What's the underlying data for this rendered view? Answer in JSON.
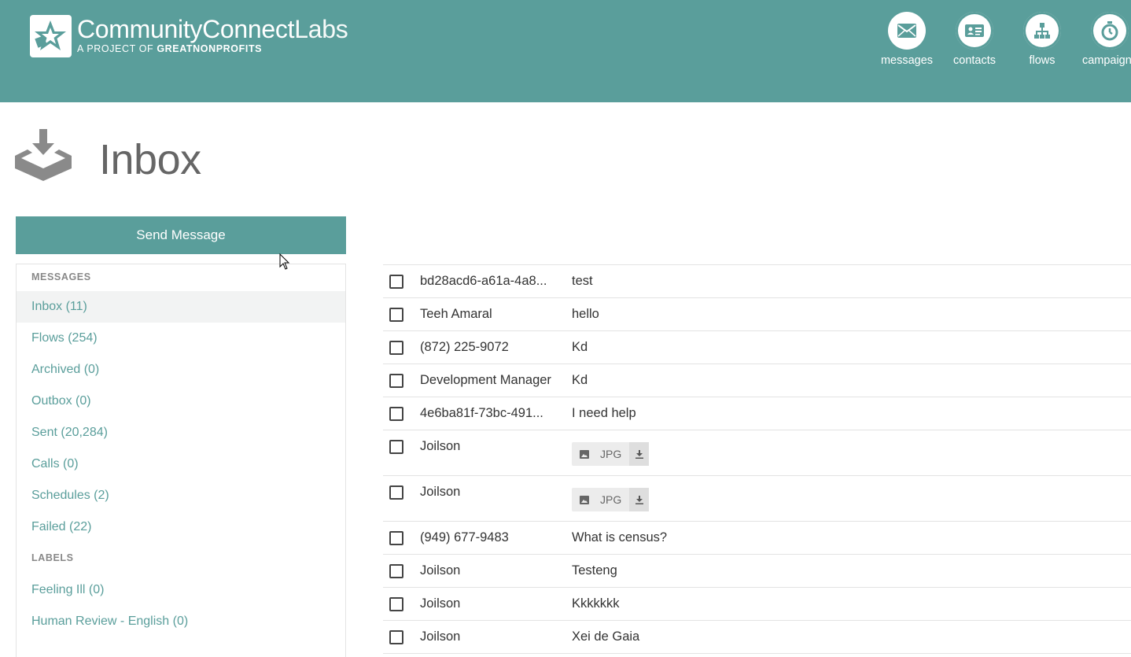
{
  "brand": {
    "title_main": "CommunityConnect",
    "title_light": "Labs",
    "subtitle_prefix": "A PROJECT OF ",
    "subtitle_bold": "GREATNONPROFITS"
  },
  "nav": {
    "items": [
      {
        "label": "messages",
        "icon": "envelope-icon"
      },
      {
        "label": "contacts",
        "icon": "contact-card-icon"
      },
      {
        "label": "flows",
        "icon": "flow-tree-icon"
      },
      {
        "label": "campaigns",
        "icon": "stopwatch-icon"
      }
    ]
  },
  "page": {
    "title": "Inbox",
    "icon": "inbox-download-icon"
  },
  "send_button": "Send Message",
  "sidebar": {
    "messages_heading": "MESSAGES",
    "items": [
      "Inbox (11)",
      "Flows (254)",
      "Archived (0)",
      "Outbox (0)",
      "Sent (20,284)",
      "Calls (0)",
      "Schedules (2)",
      "Failed (22)"
    ],
    "labels_heading": "LABELS",
    "labels": [
      "Feeling Ill (0)",
      "Human Review - English (0)"
    ]
  },
  "messages": [
    {
      "contact": "bd28acd6-a61a-4a8...",
      "text": "test"
    },
    {
      "contact": "Teeh Amaral",
      "text": "hello"
    },
    {
      "contact": "(872) 225-9072",
      "text": "Kd"
    },
    {
      "contact": "Development Manager",
      "text": "Kd"
    },
    {
      "contact": "4e6ba81f-73bc-491...",
      "text": "I need help"
    },
    {
      "contact": "Joilson",
      "attachment": "JPG"
    },
    {
      "contact": "Joilson",
      "attachment": "JPG"
    },
    {
      "contact": "(949) 677-9483",
      "text": "What is census?"
    },
    {
      "contact": "Joilson",
      "text": "Testeng"
    },
    {
      "contact": "Joilson",
      "text": "Kkkkkkk"
    },
    {
      "contact": "Joilson",
      "text": "Xei de Gaia"
    }
  ],
  "colors": {
    "brand": "#5a9e9b",
    "link": "#5a9e9b",
    "title_gray": "#666666"
  }
}
